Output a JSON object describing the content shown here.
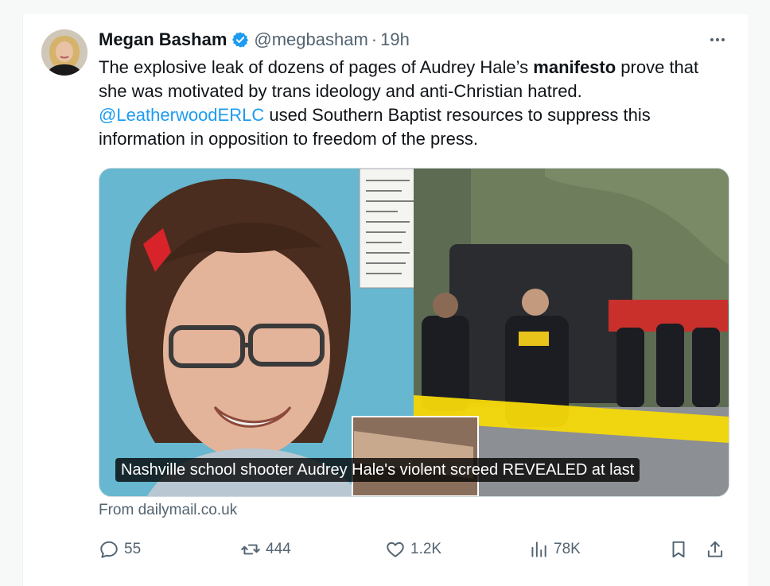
{
  "tweet": {
    "author_name": "Megan Basham",
    "handle": "@megbasham",
    "separator": "·",
    "time": "19h",
    "text_before_bold": "The explosive leak of dozens of pages of Audrey Hale’s ",
    "text_bold": "manifesto",
    "text_after_bold": " prove that she was motivated by trans ideology and anti-Christian hatred. ",
    "mention": "@LeatherwoodERLC",
    "text_end": " used Southern Baptist resources to suppress this information in opposition to freedom of the press."
  },
  "card": {
    "caption": "Nashville school shooter Audrey Hale's violent screed REVEALED at last",
    "source": "From dailymail.co.uk"
  },
  "actions": {
    "replies": "55",
    "reposts": "444",
    "likes": "1.2K",
    "views": "78K"
  },
  "icons": {
    "verified": "verified-badge-icon",
    "more": "more-horizontal-icon",
    "reply": "reply-icon",
    "repost": "repost-icon",
    "like": "heart-icon",
    "views": "views-icon",
    "bookmark": "bookmark-icon",
    "share": "share-icon"
  },
  "colors": {
    "accent": "#1d9bf0",
    "text": "#0f1419",
    "muted": "#536471"
  }
}
